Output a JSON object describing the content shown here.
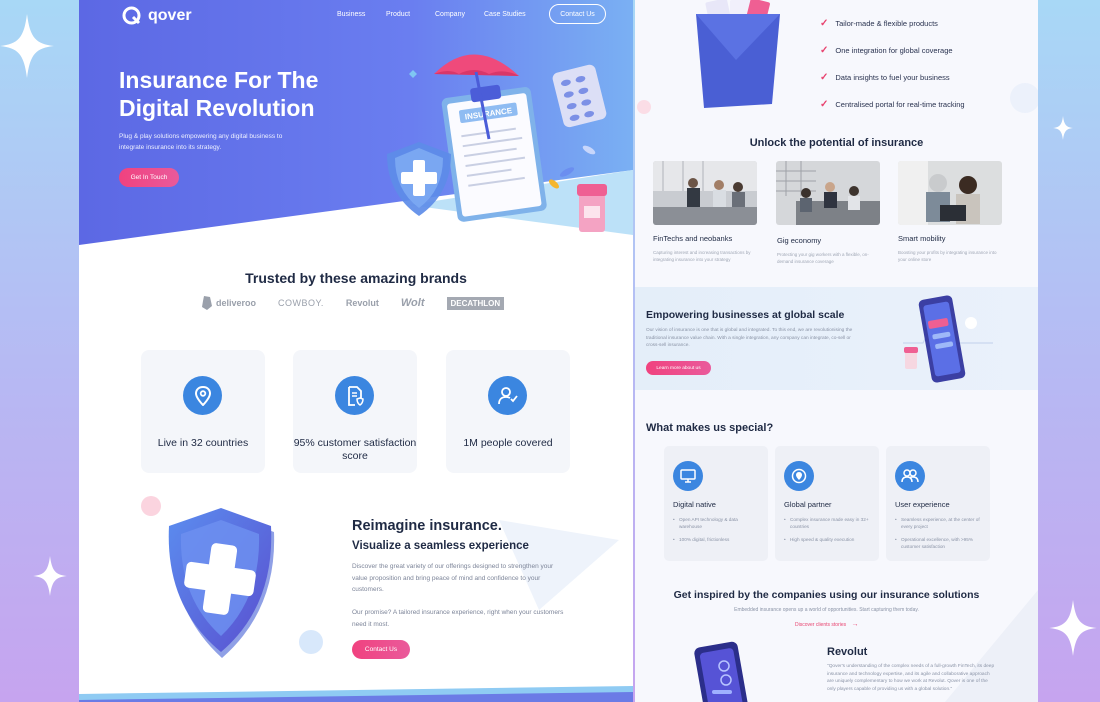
{
  "brand": {
    "name": "qover"
  },
  "nav": {
    "links": [
      "Business",
      "Product",
      "Company",
      "Case Studies"
    ],
    "cta": "Contact Us"
  },
  "hero": {
    "title": "Insurance For The Digital Revolution",
    "subtitle": "Plug & play solutions empowering any digital business to integrate insurance into its strategy.",
    "cta": "Get In Touch",
    "clipboard_label": "INSURANCE"
  },
  "brands": {
    "title": "Trusted by these amazing brands",
    "logos": [
      "deliveroo",
      "COWBOY.",
      "Revolut",
      "Wolt",
      "DECATHLON"
    ]
  },
  "stats": [
    {
      "label": "Live in 32 countries",
      "icon": "location-pin-icon"
    },
    {
      "label": "95% customer satisfaction score",
      "icon": "document-shield-icon"
    },
    {
      "label": "1M people covered",
      "icon": "user-check-icon"
    }
  ],
  "reimagine": {
    "title": "Reimagine insurance.",
    "subtitle": "Visualize a seamless experience",
    "p1": "Discover the great variety of our offerings designed to strengthen your value proposition and bring peace of mind and confidence to your customers.",
    "p2": "Our promise? A tailored insurance experience, right when your customers need it most.",
    "cta": "Contact Us"
  },
  "features_list": [
    "Tailor-made & flexible products",
    "One integration for global coverage",
    "Data insights to fuel your business",
    "Centralised portal for real-time tracking"
  ],
  "unlock": {
    "title": "Unlock the potential of insurance",
    "items": [
      {
        "title": "FinTechs and neobanks",
        "desc": "Capturing interest and increasing transactions by integrating insurance into your strategy"
      },
      {
        "title": "Gig economy",
        "desc": "Protecting your gig workers with a flexible, on-demand insurance coverage"
      },
      {
        "title": "Smart mobility",
        "desc": "Boosting your profits by integrating insurance into your online store"
      }
    ]
  },
  "empower": {
    "title": "Empowering businesses at global scale",
    "desc": "Our vision of insurance is one that is global and integrated. To this end, we are revolutionising the traditional insurance value chain. With a single integration, any company can integrate, co-sell or cross-sell insurance.",
    "cta": "Learn more about us"
  },
  "special": {
    "title": "What makes us special?",
    "cards": [
      {
        "title": "Digital native",
        "icon": "monitor-icon",
        "bullets": [
          "Open API technology & data warehouse",
          "100% digital, frictionless"
        ]
      },
      {
        "title": "Global partner",
        "icon": "globe-pin-icon",
        "bullets": [
          "Complex insurance made easy in 32+ countries",
          "High speed & quality execution"
        ]
      },
      {
        "title": "User experience",
        "icon": "users-icon",
        "bullets": [
          "Seamless experience, at the center of every project",
          "Operational excellence, with >95% customer satisfaction"
        ]
      }
    ]
  },
  "inspired": {
    "title": "Get inspired by the companies using our insurance solutions",
    "subtitle": "Embedded insurance opens up a world of opportunities. Start capturing them today.",
    "link": "Discover clients stories",
    "case_title": "Revolut",
    "case_quote": "\"Qover's understanding of the complex needs of a full-growth FinTech, its deep insurance and technology expertise, and its agile and collaborative approach are uniquely complementary to how we work at Revolut. Qover is one of the only players capable of providing us with a global solution.\""
  },
  "colors": {
    "primary": "#5b6ee8",
    "accent": "#ee4a8a",
    "blue": "#3b86e0",
    "heading": "#1f2a44"
  }
}
